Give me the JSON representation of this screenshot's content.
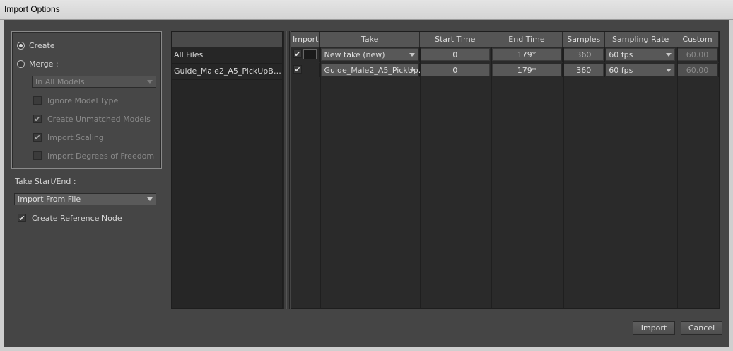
{
  "window": {
    "title": "Import Options"
  },
  "options": {
    "create_label": "Create",
    "merge_label": "Merge :",
    "merge_target": "In All Models",
    "ignore_model_type": "Ignore Model Type",
    "create_unmatched": "Create Unmatched Models",
    "import_scaling": "Import Scaling",
    "import_dof": "Import Degrees of Freedom",
    "check_mark": "✔"
  },
  "take": {
    "label": "Take Start/End :",
    "mode": "Import From File",
    "create_reference_node": "Create Reference Node"
  },
  "files": {
    "items": [
      "All Files",
      "Guide_Male2_A5_PickUpBox...."
    ]
  },
  "table": {
    "columns": {
      "import": "Import",
      "take": "Take",
      "start": "Start Time",
      "end": "End Time",
      "samples": "Samples",
      "rate": "Sampling Rate",
      "custom": "Custom"
    },
    "rows": [
      {
        "take": "New take (new)",
        "start": "0",
        "end": "179*",
        "samples": "360",
        "rate": "60 fps",
        "custom": "60.00"
      },
      {
        "take": "Guide_Male2_A5_PickUp...",
        "start": "0",
        "end": "179*",
        "samples": "360",
        "rate": "60 fps",
        "custom": "60.00"
      }
    ]
  },
  "buttons": {
    "import": "Import",
    "cancel": "Cancel"
  }
}
